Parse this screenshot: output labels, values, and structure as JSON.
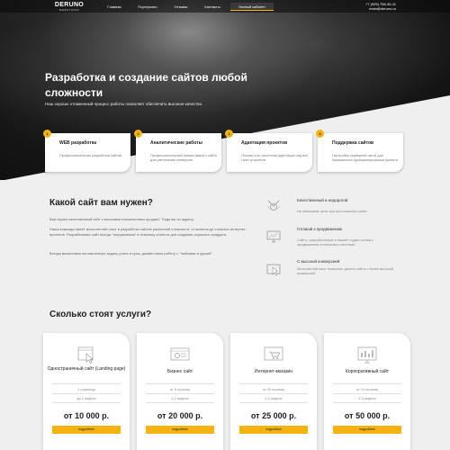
{
  "brand": {
    "name": "DERUNO",
    "tagline": "WEBSTUDIO"
  },
  "nav": {
    "items": [
      "Главная",
      "Портфолио",
      "Отзывы",
      "Контакты",
      "Личный кабинет"
    ],
    "phone": "+7 (929) 756-30-11",
    "email": "main@deruno.ru"
  },
  "hero": {
    "title": "Разработка и создание сайтов любой сложности",
    "subtitle": "Наш хорошо отлаженный процесс работы позволяет обеспечить высокое качество."
  },
  "features": [
    {
      "num": "1",
      "title": "WEB разработка",
      "desc": "Профессиональная разработка сайтов"
    },
    {
      "num": "2",
      "title": "Аналитические работы",
      "desc": "Профессиональный анализ вашего сайта для увеличения конверсии"
    },
    {
      "num": "3",
      "title": "Адаптация проектов",
      "desc": "Полная или частичная адаптация под все типы устройств"
    },
    {
      "num": "4",
      "title": "Поддержка сайтов",
      "desc": "Настройка серверной части для нормального функционирования проекта"
    }
  ],
  "which_site": {
    "title": "Какой сайт вам нужен?",
    "p1": "Вам нужен качественный сайт с высокими показателями продаж? Тогда вы по адресу.",
    "p2": "Наша команда имеет многолетний опыт в разработке сайтов различной сложности: от визиток до сложных интернет-проектов. Разрабатывая сайт всегда \"погружаемся\" в тематику клиента для создания хорошего продукта.",
    "p3": "Всегда выполняем поставленную задачу розно в срок, дизайн свою работу с \"любовью и душой\"."
  },
  "advantages": [
    {
      "icon": "medal-icon",
      "title": "Качественный и недорогой",
      "desc": "Не завышаем цены при изготовлении сайта"
    },
    {
      "icon": "monitor-chart-icon",
      "title": "Готовый к продвижению",
      "desc": "Сайты, разработанные в нашей студии готовы к продвижению в поисковых системах"
    },
    {
      "icon": "cursor-icon",
      "title": "С высокой конверсией",
      "desc": "Многолетний опыт позволяет делать сайты с более высокой конверсией"
    }
  ],
  "pricing": {
    "title": "Сколько стоят услуги?",
    "items": [
      {
        "icon": "landing-page-icon",
        "title": "Одностраничный сайт (Landing page)",
        "pages": "1 страница",
        "time": "до 1 недели",
        "price": "от 10 000 р.",
        "button": "подробнее"
      },
      {
        "icon": "business-site-icon",
        "title": "Бизнес сайт",
        "pages": "от 5 страниц",
        "time": "1-2 недели",
        "price": "от 20 000 р.",
        "button": "подробнее"
      },
      {
        "icon": "shop-icon",
        "title": "Интернет-магазин",
        "pages": "от 25 страниц",
        "time": "1-2 недели",
        "price": "от 25 000 р.",
        "button": "подробнее"
      },
      {
        "icon": "corporate-site-icon",
        "title": "Корпоративный сайт",
        "pages": "от 10 страниц",
        "time": "2-3 недели",
        "price": "от 50 000 р.",
        "button": "подробнее"
      }
    ]
  },
  "colors": {
    "accent": "#f5b312",
    "dark": "#151515",
    "bg": "#efefef"
  }
}
